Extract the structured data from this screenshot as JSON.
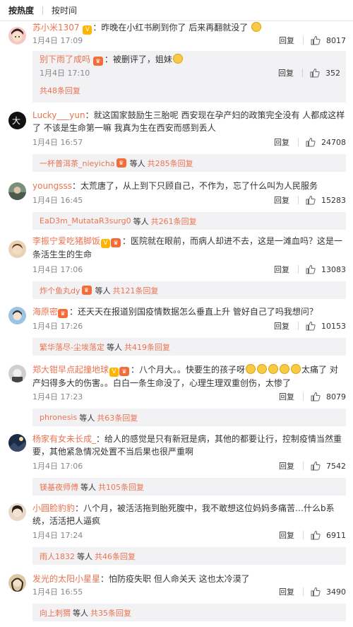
{
  "tabs": {
    "hot": "按热度",
    "time": "按时间"
  },
  "comments": [
    {
      "name": "苏小米1307",
      "sep": "：",
      "text": "昨晚在小红书刷到你了 后来再翻就没了",
      "time": "1月4日 17:09",
      "reply": "回复",
      "likes": "8017",
      "sub": {
        "name": "别下雨了成吗",
        "sep": "：",
        "text": "被删评了，姐妹",
        "time": "1月4日 17:10",
        "reply": "回复",
        "likes": "352",
        "total": "共48条回复"
      }
    },
    {
      "name": "Lucky___yun",
      "sep": "：",
      "text": "就这国家鼓励生三胎呢 西安现在孕产妇的政策完全没有 人都成这样了 不该是生命第一嘛 我真为生在西安而感到丢人",
      "time": "1月4日 16:57",
      "reply": "回复",
      "likes": "24708",
      "replybar": {
        "user": "一杯普洱茶_nieyicha",
        "etc": "等人",
        "total": "共285条回复"
      }
    },
    {
      "name": "youngsss",
      "sep": "：",
      "text": "太荒唐了，从上到下只顾自己，不作为，忘了什么叫为人民服务",
      "time": "1月4日 16:45",
      "reply": "回复",
      "likes": "15283",
      "replybar": {
        "user": "EaD3m_MutataR3surg0",
        "etc": "等人",
        "total": "共261条回复"
      }
    },
    {
      "name": "李振宁爱吃猪脚饭",
      "sep": "：",
      "text": "医院就在眼前，而病人却进不去，这是一滩血吗？这是一条活生生的生命",
      "time": "1月4日 17:06",
      "reply": "回复",
      "likes": "13083",
      "replybar": {
        "user": "炸个鱼丸dy",
        "etc": "等人",
        "total": "共121条回复"
      }
    },
    {
      "name": "海原密",
      "sep": "：",
      "text": "还天天在报道别国疫情数据怎么垂直上升 管好自己了吗我想问？",
      "time": "1月4日 17:26",
      "reply": "回复",
      "likes": "10153",
      "replybar": {
        "user": "繁华落尽-尘埃落定",
        "etc": "等人",
        "total": "共419条回复"
      }
    },
    {
      "name": "郑大钳早点起撞地球",
      "sep": "：",
      "text1": "八个月大。。快要生的孩子呀",
      "text2": "太痛了 对产妇得多大的伤害。。白白一条生命没了，心理生理双重创伤，太惨了",
      "time": "1月4日 17:23",
      "reply": "回复",
      "likes": "8079",
      "replybar": {
        "user": "phronesis",
        "etc": "等人",
        "total": "共63条回复"
      }
    },
    {
      "name": "杨家有女未长成_",
      "sep": "：",
      "text": "给人的感觉是只有新冠是病，其他的都要让行，控制疫情当然重要，其他紧急情况处置不当后果也很严重啊",
      "time": "1月4日 17:06",
      "reply": "回复",
      "likes": "7542",
      "replybar": {
        "user": "镁基夜师傅",
        "etc": "等人",
        "total": "共105条回复"
      }
    },
    {
      "name": "小圆脸豹豹",
      "sep": "：",
      "text": "八个月，被活活拖到胎死腹中，我不敢想这位妈妈多痛苦…什么b系统，活活把人逼疯",
      "time": "1月4日 17:24",
      "reply": "回复",
      "likes": "6911",
      "replybar": {
        "user": "雨人1832",
        "etc": "等人",
        "total": "共46条回复"
      }
    },
    {
      "name": "发光的太阳小星星",
      "sep": "：",
      "text": "怕防疫失职 但人命关天 这也太冷漠了",
      "time": "1月4日 16:55",
      "reply": "回复",
      "likes": "3490",
      "replybar": {
        "user": "向上刺猬",
        "etc": "等人",
        "total": "共35条回复"
      }
    }
  ],
  "colors": {
    "name": "#eb7350",
    "bg_sub": "#f2f2f5",
    "text": "#333333",
    "meta": "#888888"
  },
  "icons": [
    "thumb-up-icon",
    "vip-badge-icon",
    "member-crown-icon",
    "emoji-icon"
  ]
}
